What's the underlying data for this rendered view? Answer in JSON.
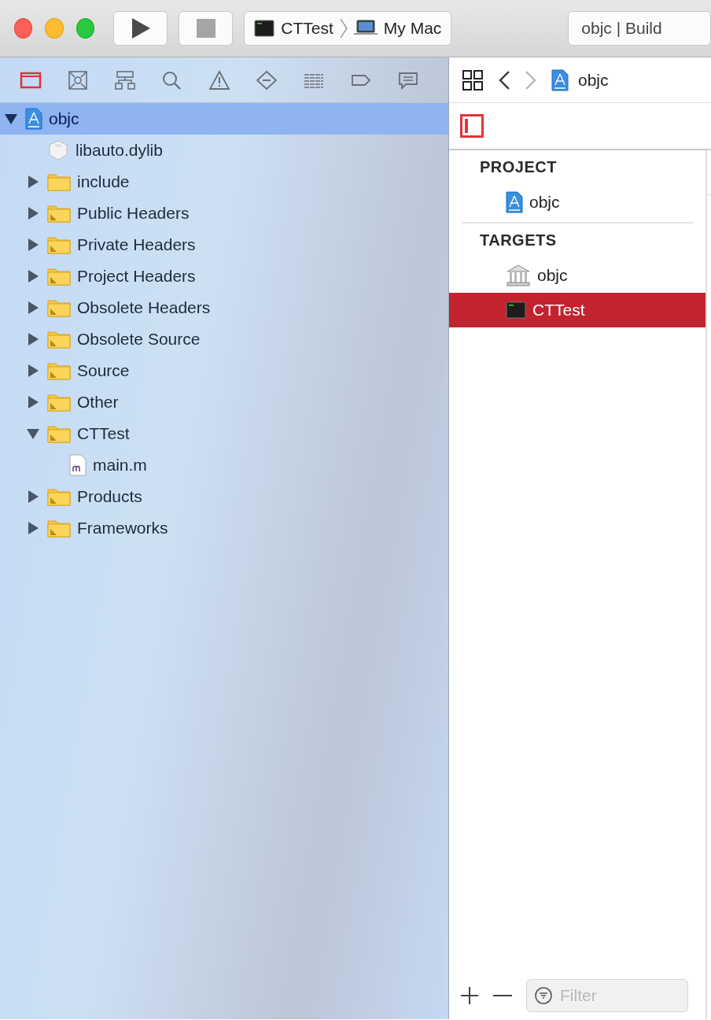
{
  "toolbar": {
    "scheme": {
      "target": "CTTest",
      "destination": "My Mac"
    },
    "activity": "objc | Build"
  },
  "navigator": {
    "tabs": [
      {
        "kind": "folder",
        "selected": true
      },
      {
        "kind": "symbol",
        "selected": false
      },
      {
        "kind": "hierarchy",
        "selected": false
      },
      {
        "kind": "search",
        "selected": false
      },
      {
        "kind": "warning",
        "selected": false
      },
      {
        "kind": "test",
        "selected": false
      },
      {
        "kind": "debug",
        "selected": false
      },
      {
        "kind": "breakpoint",
        "selected": false
      },
      {
        "kind": "report",
        "selected": false
      }
    ],
    "tree": [
      {
        "label": "objc",
        "kind": "project",
        "expanded": true,
        "selected": true,
        "children": [
          {
            "label": "libauto.dylib",
            "kind": "dylib",
            "selected": false
          },
          {
            "label": "include",
            "kind": "folder",
            "expanded": false,
            "selected": false
          },
          {
            "label": "Public Headers",
            "kind": "group",
            "expanded": false,
            "selected": false
          },
          {
            "label": "Private Headers",
            "kind": "group",
            "expanded": false,
            "selected": false
          },
          {
            "label": "Project Headers",
            "kind": "group",
            "expanded": false,
            "selected": false
          },
          {
            "label": "Obsolete Headers",
            "kind": "group",
            "expanded": false,
            "selected": false
          },
          {
            "label": "Obsolete Source",
            "kind": "group",
            "expanded": false,
            "selected": false
          },
          {
            "label": "Source",
            "kind": "group",
            "expanded": false,
            "selected": false
          },
          {
            "label": "Other",
            "kind": "group",
            "expanded": false,
            "selected": false
          },
          {
            "label": "CTTest",
            "kind": "group",
            "expanded": true,
            "selected": false,
            "children": [
              {
                "label": "main.m",
                "kind": "source",
                "selected": false
              }
            ]
          },
          {
            "label": "Products",
            "kind": "group",
            "expanded": false,
            "selected": false
          },
          {
            "label": "Frameworks",
            "kind": "group",
            "expanded": false,
            "selected": false
          }
        ]
      }
    ]
  },
  "editor": {
    "jump_bar": {
      "forward_disabled": true,
      "file": "objc"
    },
    "sections": [
      {
        "title": "PROJECT",
        "items": [
          {
            "label": "objc",
            "kind": "project",
            "selected": false
          }
        ]
      },
      {
        "title": "TARGETS",
        "items": [
          {
            "label": "objc",
            "kind": "library",
            "selected": false
          },
          {
            "label": "CTTest",
            "kind": "terminal",
            "selected": true
          }
        ]
      }
    ],
    "filter": {
      "placeholder": "Filter"
    }
  }
}
